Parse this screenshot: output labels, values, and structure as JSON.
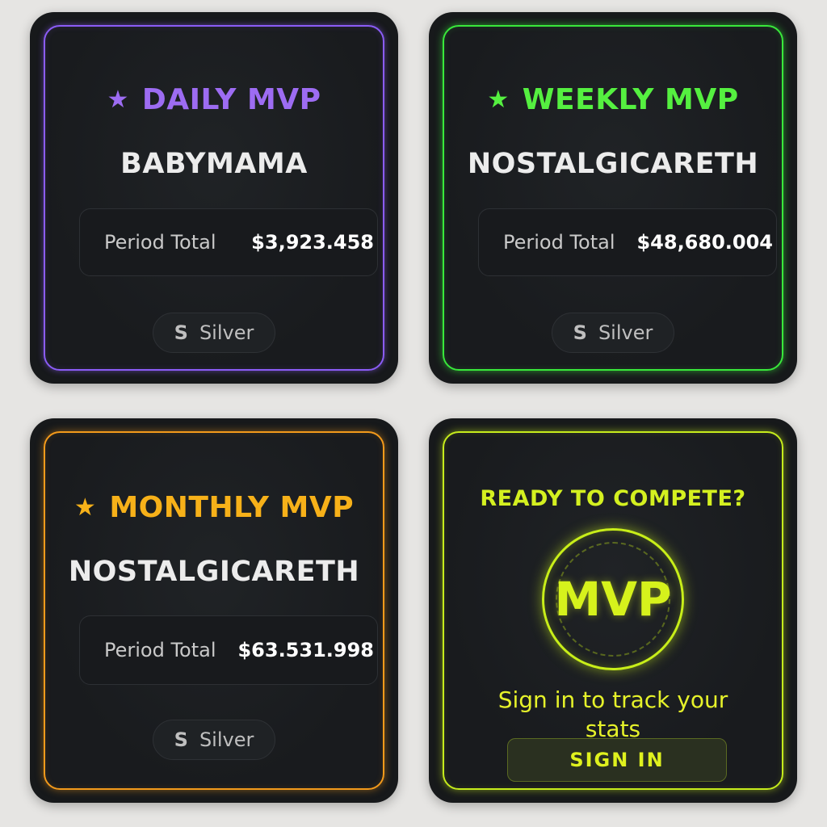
{
  "cards": [
    {
      "star_icon": "star-icon",
      "title": "DAILY MVP",
      "player": "BABYMAMA",
      "total_label": "Period Total",
      "total_value": "$3,923.458",
      "badge_letter": "S",
      "badge_label": "Silver",
      "accent": "#8b5cf6"
    },
    {
      "star_icon": "star-icon",
      "title": "WEEKLY MVP",
      "player": "NOSTALGICARETH",
      "total_label": "Period Total",
      "total_value": "$48,680.004",
      "badge_letter": "S",
      "badge_label": "Silver",
      "accent": "#39e83b"
    },
    {
      "star_icon": "star-icon",
      "title": "MONTHLY MVP",
      "player": "NOSTALGICARETH",
      "total_label": "Period Total",
      "total_value": "$63.531.998",
      "badge_letter": "S",
      "badge_label": "Silver",
      "accent": "#f39a1b"
    }
  ],
  "cta": {
    "heading": "READY TO COMPETE?",
    "emblem_text": "MVP",
    "message": "Sign in to track your stats",
    "button_label": "SIGN IN",
    "accent": "#c6ec1c"
  }
}
